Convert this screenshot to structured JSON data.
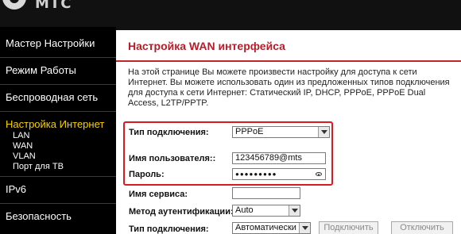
{
  "brand": {
    "logo_text": "МТС"
  },
  "sidebar": {
    "items": [
      {
        "label": "Мастер Настройки"
      },
      {
        "label": "Режим Работы"
      },
      {
        "label": "Беспроводная сеть"
      },
      {
        "label": "Настройка Интернет",
        "active": true
      },
      {
        "label": "IPv6"
      },
      {
        "label": "Безопасность"
      }
    ],
    "subitems": [
      {
        "label": "LAN"
      },
      {
        "label": "WAN"
      },
      {
        "label": "VLAN"
      },
      {
        "label": "Порт для ТВ"
      }
    ]
  },
  "main": {
    "title": "Настройка WAN интерфейса",
    "description": [
      "На этой странице Вы можете произвести настройку для доступа к сети",
      "Интернет. Вы можете использовать один из предложенных типов подключения",
      "для доступа к сети Интернет: Статический IP, DHCP, PPPoE, PPPoE Dual",
      "Access, L2TP/PPTP."
    ],
    "form": {
      "connection_type_label": "Тип подключения:",
      "connection_type_value": "PPPoE",
      "username_label": "Имя пользователя::",
      "username_value": "123456789@mts",
      "password_label": "Пароль:",
      "password_value": "●●●●●●●●●",
      "service_name_label": "Имя сервиса:",
      "service_name_value": "",
      "auth_method_label": "Метод аутентификации:",
      "auth_method_value": "Auto",
      "connect_type_label": "Тип подключения:",
      "connect_type_value": "Автоматически",
      "connect_button": "Подключить",
      "disconnect_button": "Отключить"
    }
  },
  "colors": {
    "accent_red": "#c0272d",
    "active_nav": "#f6d000",
    "sidebar_bg": "#000000"
  }
}
